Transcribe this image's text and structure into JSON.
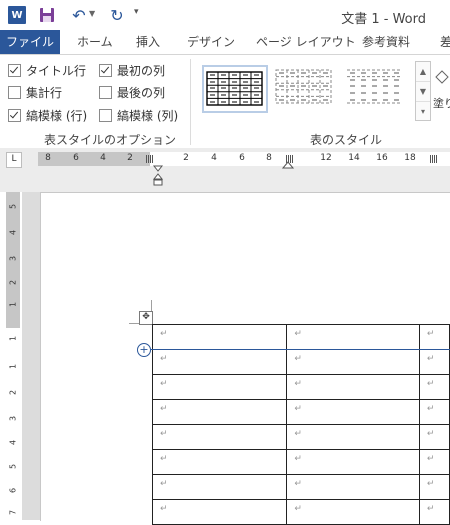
{
  "titlebar": {
    "word_icon_letter": "W",
    "document_title": "文書 1 - Word"
  },
  "tabs": [
    "ファイル",
    "ホーム",
    "挿入",
    "デザイン",
    "ページ レイアウト",
    "参考資料",
    "差"
  ],
  "table_style_options": {
    "checkboxes": [
      {
        "label": "タイトル行",
        "checked": true
      },
      {
        "label": "最初の列",
        "checked": true
      },
      {
        "label": "集計行",
        "checked": false
      },
      {
        "label": "最後の列",
        "checked": false
      },
      {
        "label": "縞模様 (行)",
        "checked": true
      },
      {
        "label": "縞模様 (列)",
        "checked": false
      }
    ],
    "group_label": "表スタイルのオプション"
  },
  "table_styles": {
    "group_label": "表のスタイル",
    "shading_label": "塗り"
  },
  "ruler": {
    "tab_selector": "L",
    "h_numbers_left": [
      "8",
      "6",
      "4",
      "2"
    ],
    "h_numbers_right": [
      "2",
      "4",
      "6",
      "8",
      "12",
      "14",
      "16",
      "18"
    ],
    "v_numbers": [
      "5",
      "4",
      "3",
      "2",
      "1",
      "1",
      "1",
      "2",
      "3",
      "4",
      "5",
      "6",
      "7"
    ]
  },
  "document": {
    "paragraph_mark": "↵",
    "table_rows": 8,
    "table_cols": 3
  }
}
